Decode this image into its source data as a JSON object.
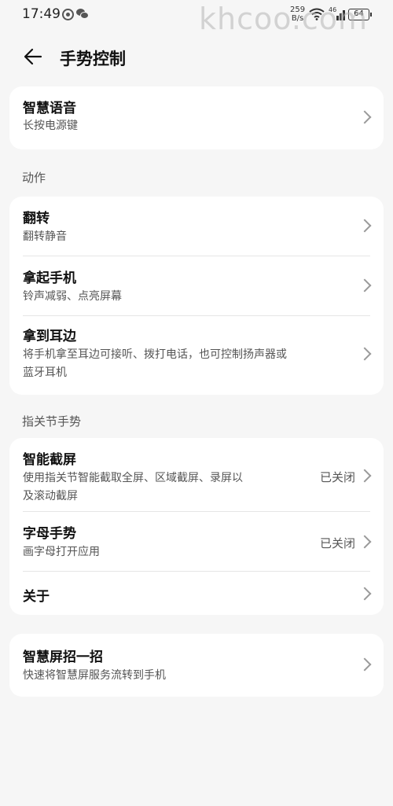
{
  "status_bar": {
    "time": "17:49",
    "speed_top": "259",
    "speed_bottom": "B/s",
    "signal_type": "46",
    "battery": "64"
  },
  "watermark": "khcoo.com",
  "header": {
    "title": "手势控制"
  },
  "card_voice": {
    "title": "智慧语音",
    "subtitle": "长按电源键"
  },
  "section_actions": "动作",
  "actions": [
    {
      "title": "翻转",
      "subtitle": "翻转静音"
    },
    {
      "title": "拿起手机",
      "subtitle": "铃声减弱、点亮屏幕"
    },
    {
      "title": "拿到耳边",
      "subtitle_line1": "将手机拿至耳边可接听、拨打电话，也可控制扬声器或",
      "subtitle_line2": "蓝牙耳机"
    }
  ],
  "section_knuckle": "指关节手势",
  "knuckle": [
    {
      "title": "智能截屏",
      "subtitle_line1": "使用指关节智能截取全屏、区域截屏、录屏以",
      "subtitle_line2": "及滚动截屏",
      "state": "已关闭"
    },
    {
      "title": "字母手势",
      "subtitle": "画字母打开应用",
      "state": "已关闭"
    },
    {
      "title": "关于"
    }
  ],
  "card_smartscreen": {
    "title": "智慧屏招一招",
    "subtitle": "快速将智慧屏服务流转到手机"
  },
  "colors": {
    "background": "#f6f6f6",
    "card": "#ffffff",
    "chevron": "#9a9a9a"
  }
}
